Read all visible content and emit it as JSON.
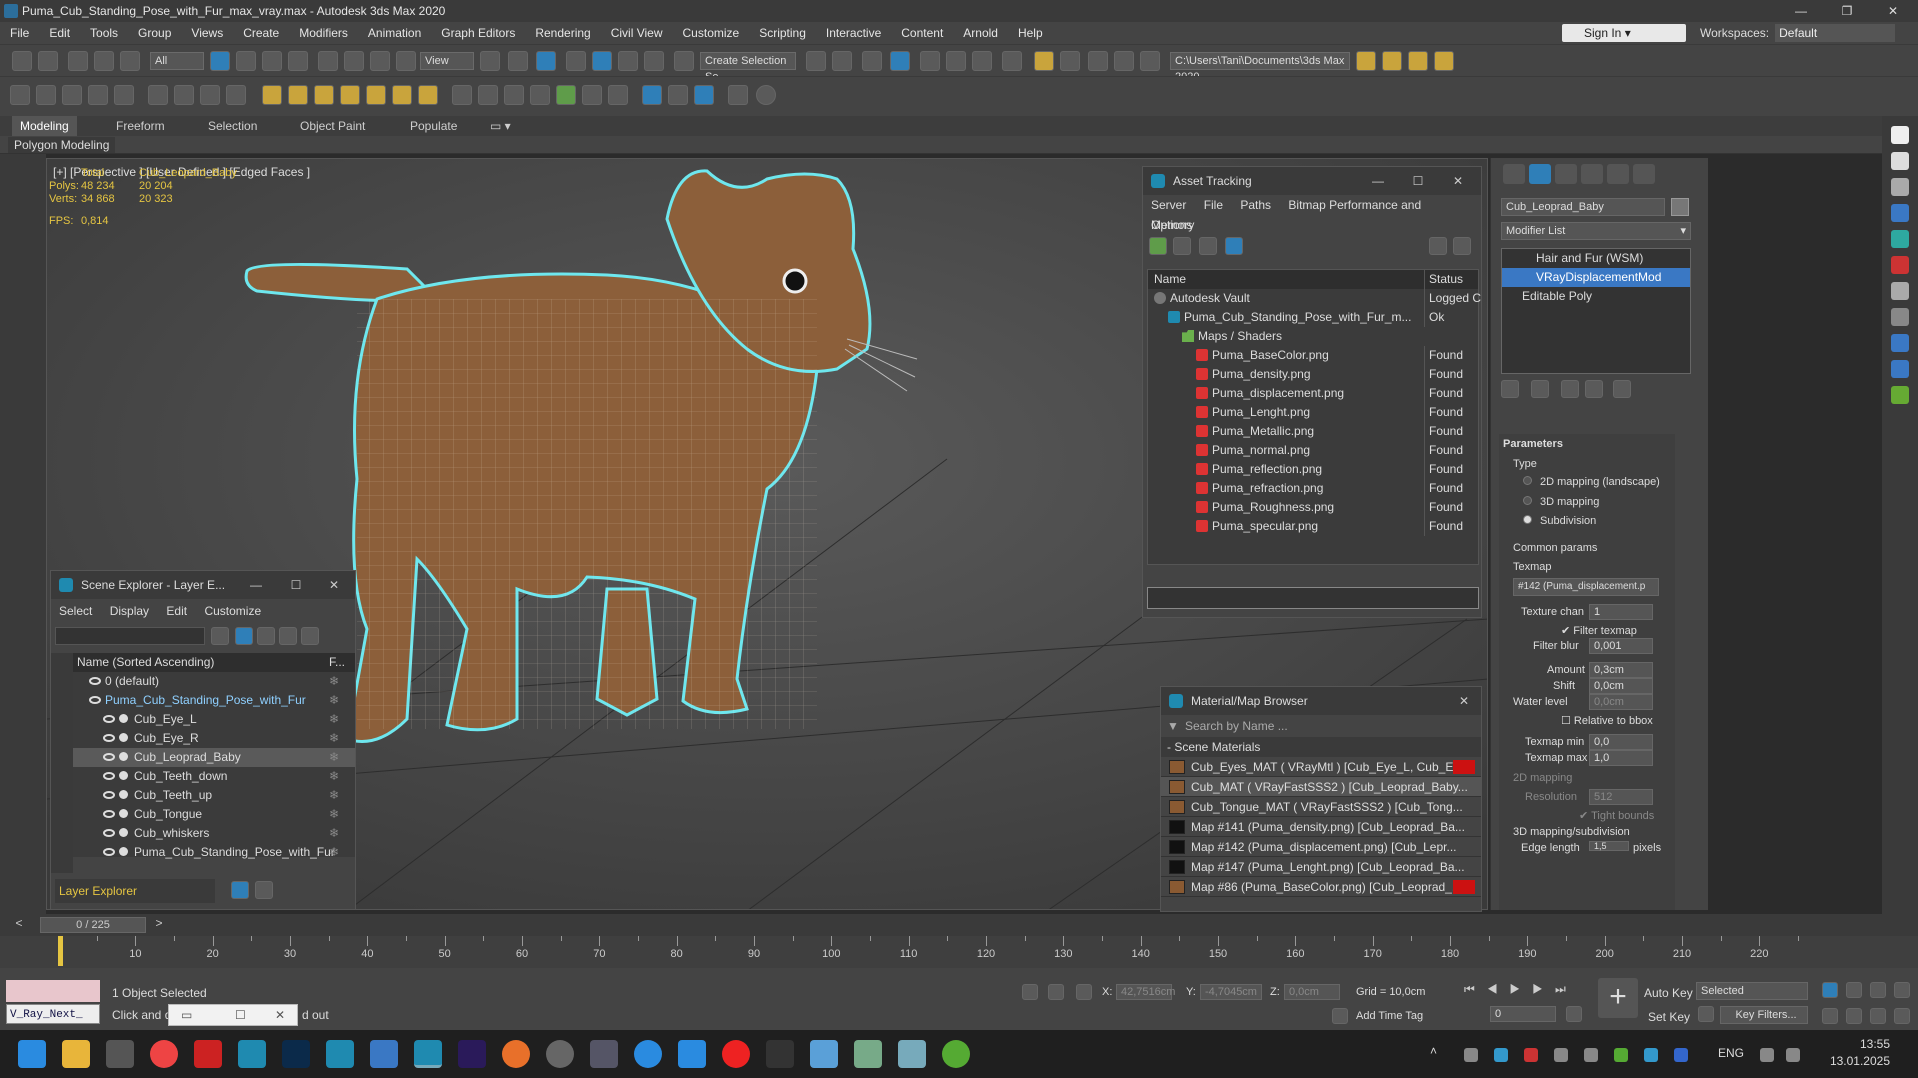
{
  "window": {
    "title": "Puma_Cub_Standing_Pose_with_Fur_max_vray.max - Autodesk 3ds Max 2020"
  },
  "menu": [
    "File",
    "Edit",
    "Tools",
    "Group",
    "Views",
    "Create",
    "Modifiers",
    "Animation",
    "Graph Editors",
    "Rendering",
    "Civil View",
    "Customize",
    "Scripting",
    "Interactive",
    "Content",
    "Arnold",
    "Help"
  ],
  "signin": "Sign In",
  "workspaces": {
    "label": "Workspaces:",
    "value": "Default"
  },
  "toolbar": {
    "selection_filter": "All",
    "ref_coord": "View",
    "named_selection": "Create Selection Se",
    "project_path": "C:\\Users\\Tani\\Documents\\3ds Max 2020"
  },
  "ribbon": {
    "tabs": [
      "Modeling",
      "Freeform",
      "Selection",
      "Object Paint",
      "Populate"
    ],
    "sub": "Polygon Modeling"
  },
  "viewport": {
    "label": "[+] [Perspective ] [User Defined ] [Edged Faces ]",
    "stats": {
      "total": "Total",
      "object": "Cub_Leopard_Baby",
      "polys_label": "Polys:",
      "polys_total": "48 234",
      "polys_obj": "20 204",
      "verts_label": "Verts:",
      "verts_total": "34 868",
      "verts_obj": "20 323",
      "fps_label": "FPS:",
      "fps": "0,814"
    }
  },
  "asset_tracking": {
    "title": "Asset Tracking",
    "menu": [
      "Server",
      "File",
      "Paths",
      "Bitmap Performance and Memory",
      "Options"
    ],
    "col_name": "Name",
    "col_status": "Status",
    "rows": [
      {
        "name": "Autodesk Vault",
        "status": "Logged C",
        "indent": 0,
        "icon": "vault"
      },
      {
        "name": "Puma_Cub_Standing_Pose_with_Fur_m...",
        "status": "Ok",
        "indent": 1,
        "icon": "max"
      },
      {
        "name": "Maps / Shaders",
        "status": "",
        "indent": 2,
        "icon": "folder"
      },
      {
        "name": "Puma_BaseColor.png",
        "status": "Found",
        "indent": 3,
        "icon": "png"
      },
      {
        "name": "Puma_density.png",
        "status": "Found",
        "indent": 3,
        "icon": "png"
      },
      {
        "name": "Puma_displacement.png",
        "status": "Found",
        "indent": 3,
        "icon": "png"
      },
      {
        "name": "Puma_Lenght.png",
        "status": "Found",
        "indent": 3,
        "icon": "png"
      },
      {
        "name": "Puma_Metallic.png",
        "status": "Found",
        "indent": 3,
        "icon": "png"
      },
      {
        "name": "Puma_normal.png",
        "status": "Found",
        "indent": 3,
        "icon": "png"
      },
      {
        "name": "Puma_reflection.png",
        "status": "Found",
        "indent": 3,
        "icon": "png"
      },
      {
        "name": "Puma_refraction.png",
        "status": "Found",
        "indent": 3,
        "icon": "png"
      },
      {
        "name": "Puma_Roughness.png",
        "status": "Found",
        "indent": 3,
        "icon": "png"
      },
      {
        "name": "Puma_specular.png",
        "status": "Found",
        "indent": 3,
        "icon": "png"
      }
    ]
  },
  "scene_explorer": {
    "title": "Scene Explorer - Layer E...",
    "menu": [
      "Select",
      "Display",
      "Edit",
      "Customize"
    ],
    "col": "Name (Sorted Ascending)",
    "col2": "F...",
    "rows": [
      {
        "name": "0 (default)",
        "indent": 1
      },
      {
        "name": "Puma_Cub_Standing_Pose_with_Fur",
        "indent": 1
      },
      {
        "name": "Cub_Eye_L",
        "indent": 2
      },
      {
        "name": "Cub_Eye_R",
        "indent": 2
      },
      {
        "name": "Cub_Leoprad_Baby",
        "indent": 2
      },
      {
        "name": "Cub_Teeth_down",
        "indent": 2
      },
      {
        "name": "Cub_Teeth_up",
        "indent": 2
      },
      {
        "name": "Cub_Tongue",
        "indent": 2
      },
      {
        "name": "Cub_whiskers",
        "indent": 2
      },
      {
        "name": "Puma_Cub_Standing_Pose_with_Fur",
        "indent": 2
      }
    ],
    "footer": "Layer Explorer"
  },
  "material_browser": {
    "title": "Material/Map Browser",
    "search_placeholder": "Search by Name ...",
    "group": "- Scene Materials",
    "rows": [
      "Cub_Eyes_MAT ( VRayMtl ) [Cub_Eye_L, Cub_Ey...",
      "Cub_MAT ( VRayFastSSS2 ) [Cub_Leoprad_Baby...",
      "Cub_Tongue_MAT ( VRayFastSSS2 ) [Cub_Tong...",
      "Map #141 (Puma_density.png) [Cub_Leoprad_Ba...",
      "Map #142 (Puma_displacement.png) [Cub_Lepr...",
      "Map #147 (Puma_Lenght.png) [Cub_Leoprad_Ba...",
      "Map #86 (Puma_BaseColor.png) [Cub_Leoprad_..."
    ]
  },
  "command_panel": {
    "object_name": "Cub_Leoprad_Baby",
    "modifier_list": "Modifier List",
    "stack": [
      "Hair and Fur (WSM)",
      "VRayDisplacementMod",
      "Editable Poly"
    ],
    "parameters": "Parameters",
    "type_label": "Type",
    "types": [
      "2D mapping (landscape)",
      "3D mapping",
      "Subdivision"
    ],
    "common_params": "Common params",
    "texmap_label": "Texmap",
    "texmap_value": "#142 (Puma_displacement.p",
    "texture_chan_label": "Texture chan",
    "texture_chan": "1",
    "filter_texmap": "Filter texmap",
    "filter_blur_label": "Filter blur",
    "filter_blur": "0,001",
    "amount_label": "Amount",
    "amount": "0,3cm",
    "shift_label": "Shift",
    "shift": "0,0cm",
    "water_label": "Water level",
    "water": "0,0cm",
    "relative_bbox": "Relative to bbox",
    "texmap_min_label": "Texmap min",
    "texmap_min": "0,0",
    "texmap_max_label": "Texmap max",
    "texmap_max": "1,0",
    "mapping2d": "2D mapping",
    "resolution_label": "Resolution",
    "resolution": "512",
    "tight_bounds": "Tight bounds",
    "mapping3d": "3D mapping/subdivision",
    "edge_length_label": "Edge length",
    "edge_length": "1,5",
    "pixels": "pixels"
  },
  "timeline": {
    "frame": "0 / 225",
    "ticks": [
      "10",
      "20",
      "30",
      "40",
      "50",
      "60",
      "70",
      "80",
      "90",
      "100",
      "110",
      "120",
      "130",
      "140",
      "150",
      "160",
      "170",
      "180",
      "190",
      "200",
      "210",
      "220"
    ]
  },
  "status": {
    "script_label": "V_Ray_Next_",
    "selected": "1 Object Selected",
    "hint": "Click and dra",
    "hint_tail": "d out",
    "x_label": "X:",
    "x": "42,7516cm",
    "y_label": "Y:",
    "y": "-4,7045cm",
    "z_label": "Z:",
    "z": "0,0cm",
    "grid": "Grid = 10,0cm",
    "add_time_tag": "Add Time Tag",
    "auto_key": "Auto Key",
    "set_key": "Set Key",
    "key_mode": "Selected",
    "key_filters": "Key Filters...",
    "frame_field": "0"
  },
  "taskbar": {
    "lang": "ENG",
    "time": "13:55",
    "date": "13.01.2025"
  }
}
